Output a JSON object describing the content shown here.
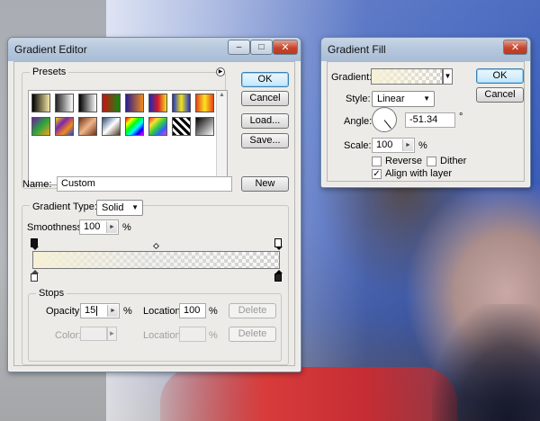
{
  "gradient_editor": {
    "title": "Gradient Editor",
    "presets_label": "Presets",
    "ok_label": "OK",
    "cancel_label": "Cancel",
    "load_label": "Load...",
    "save_label": "Save...",
    "name_label": "Name:",
    "name_value": "Custom",
    "new_label": "New",
    "gradient_type_label": "Gradient Type:",
    "gradient_type_value": "Solid",
    "smoothness_label": "Smoothness:",
    "smoothness_value": "100",
    "percent": "%",
    "stops_label": "Stops",
    "opacity_label": "Opacity:",
    "opacity_value": "15",
    "location_label": "Location:",
    "location_value": "100",
    "delete_label": "Delete",
    "color_label": "Color:",
    "color_location_label": "Location:",
    "color_location_value": "",
    "gradient_bar_colors": [
      "#f6f0d6",
      "#d8d8d8"
    ]
  },
  "gradient_fill": {
    "title": "Gradient Fill",
    "gradient_label": "Gradient:",
    "ok_label": "OK",
    "cancel_label": "Cancel",
    "style_label": "Style:",
    "style_value": "Linear",
    "angle_label": "Angle:",
    "angle_value": "-51.34",
    "degree_symbol": "°",
    "scale_label": "Scale:",
    "scale_value": "100",
    "percent": "%",
    "reverse_label": "Reverse",
    "reverse_checked": false,
    "dither_label": "Dither",
    "dither_checked": false,
    "align_label": "Align with layer",
    "align_checked": true
  },
  "preset_swatches": [
    {
      "icon": "black-white-gradient",
      "colors": [
        "#000000",
        "#f5e7a5"
      ]
    },
    {
      "icon": "fg-transparent-gradient",
      "colors": [
        "#222222",
        "#ffffff"
      ]
    },
    {
      "icon": "black-white-gradient",
      "colors": [
        "#000000",
        "#ffffff"
      ]
    },
    {
      "icon": "red-green-gradient",
      "colors": [
        "#cc1111",
        "#118811"
      ]
    },
    {
      "icon": "violet-orange-gradient",
      "colors": [
        "#2b1c8c",
        "#f28a1e"
      ]
    },
    {
      "icon": "blue-red-yellow-gradient",
      "colors": [
        "#1a2bb5",
        "#d4192b",
        "#f6e01b"
      ]
    },
    {
      "icon": "blue-yellow-blue-gradient",
      "colors": [
        "#1b33c9",
        "#f2e21b",
        "#1b33c9"
      ]
    },
    {
      "icon": "orange-yellow-orange-gradient",
      "colors": [
        "#e44516",
        "#fbe323",
        "#e44516"
      ]
    },
    {
      "icon": "violet-green-orange-gradient",
      "colors": [
        "#6a1ca8",
        "#2aa53c",
        "#f7a31b"
      ]
    },
    {
      "icon": "yellow-violet-orange-blue-gradient",
      "colors": [
        "#f0d41e",
        "#7d27a6",
        "#f08a1e",
        "#2a43c2"
      ]
    },
    {
      "icon": "copper-gradient",
      "colors": [
        "#6b3218",
        "#f0b48a",
        "#6b3218"
      ]
    },
    {
      "icon": "chrome-gradient",
      "colors": [
        "#2a4b7a",
        "#ffffff",
        "#4a3a20"
      ]
    },
    {
      "icon": "spectrum-gradient",
      "colors": [
        "#ff0000",
        "#ffff00",
        "#00ff00",
        "#00ffff",
        "#0000ff",
        "#ff00ff"
      ]
    },
    {
      "icon": "transparent-rainbow-gradient",
      "colors": [
        "#ff3030",
        "#ffe030",
        "#30d040",
        "#3060ff",
        "#e040e0"
      ]
    },
    {
      "icon": "transparent-stripes-gradient",
      "colors": [
        "#000000",
        "#ffffff"
      ]
    },
    {
      "icon": "black-white-gradient",
      "colors": [
        "#000000",
        "#ffffff"
      ]
    }
  ]
}
